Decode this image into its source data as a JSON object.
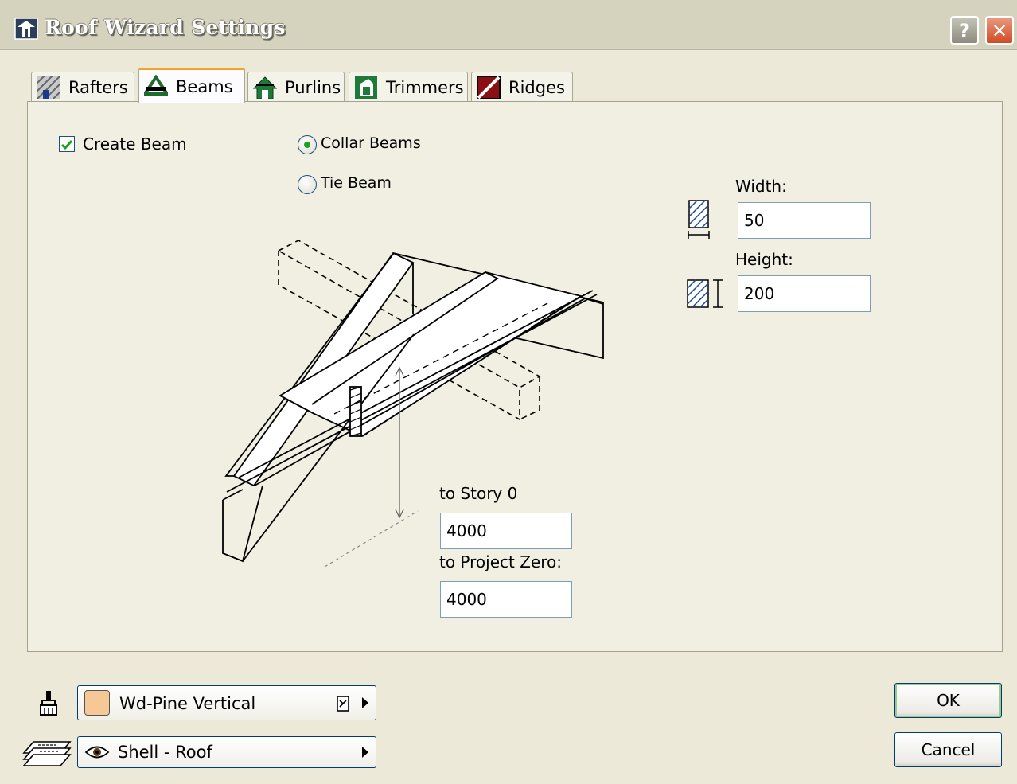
{
  "window": {
    "title": "Roof Wizard Settings",
    "help_label": "?",
    "close_label": "✕"
  },
  "tabs": [
    {
      "label": "Rafters",
      "icon": "rafters-icon",
      "active": false
    },
    {
      "label": "Beams",
      "icon": "beams-icon",
      "active": true
    },
    {
      "label": "Purlins",
      "icon": "purlins-icon",
      "active": false
    },
    {
      "label": "Trimmers",
      "icon": "trimmers-icon",
      "active": false
    },
    {
      "label": "Ridges",
      "icon": "ridges-icon",
      "active": false
    }
  ],
  "beams": {
    "create_beam_label": "Create Beam",
    "create_beam_checked": true,
    "beam_type_options": [
      "Collar Beams",
      "Tie Beam"
    ],
    "beam_type_selected": "Collar Beams",
    "width_label": "Width:",
    "width_value": "50",
    "height_label": "Height:",
    "height_value": "200",
    "to_story_label": "to Story 0",
    "to_story_value": "4000",
    "to_project_zero_label": "to Project Zero:",
    "to_project_zero_value": "4000"
  },
  "material": {
    "icon": "paintbrush-icon",
    "swatch_color": "#f5c896",
    "value": "Wd-Pine Vertical"
  },
  "layer": {
    "icon": "layers-icon",
    "value": "Shell - Roof"
  },
  "buttons": {
    "ok_label": "OK",
    "cancel_label": "Cancel"
  },
  "colors": {
    "title_bar": "#d5d2be",
    "dialog_bg": "#ece9d8",
    "tab_active_accent": "#f3a32a",
    "check_green": "#21a121"
  }
}
